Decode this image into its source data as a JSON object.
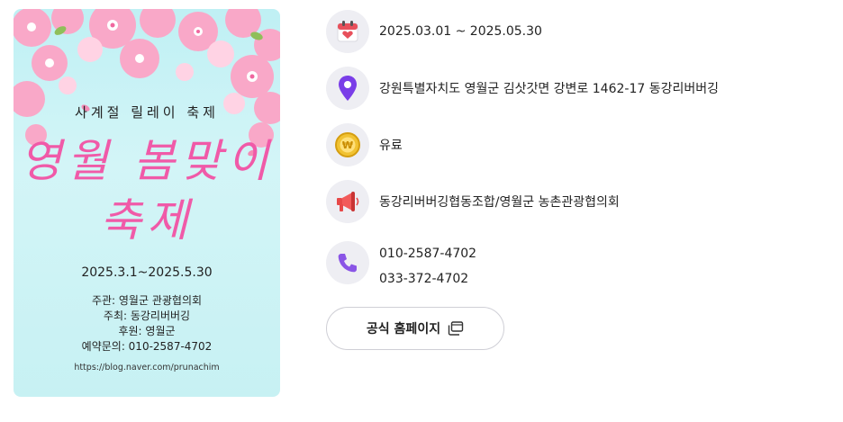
{
  "poster": {
    "subtitle": "사계절 릴레이 축제",
    "title_line1": "영월 봄맞이",
    "title_line2": "축제",
    "dates": "2025.3.1~2025.5.30",
    "organizer": "주관: 영월군 관광협의회",
    "host": "주최: 동강리버버깅",
    "sponsor": "후원: 영월군",
    "reservation": "예약문의: 010-2587-4702",
    "url": "https://blog.naver.com/prunachim"
  },
  "info": {
    "period": "2025.03.01 ~ 2025.05.30",
    "address": "강원특별자치도 영월군 김삿갓면 강변로 1462-17 동강리버버깅",
    "fee": "유료",
    "organizer": "동강리버버깅협동조합/영월군 농촌관광협의회",
    "phone1": "010-2587-4702",
    "phone2": "033-372-4702",
    "homepage_button": "공식 홈페이지"
  },
  "icons": {
    "calendar": "calendar-heart-icon",
    "location": "map-pin-icon",
    "fee": "coin-icon",
    "organizer": "megaphone-icon",
    "phone": "phone-icon",
    "external": "new-window-icon"
  },
  "colors": {
    "poster_title": "#f05aa8",
    "icon_bg": "#eeeef3",
    "pin": "#7a3ee8",
    "phone": "#8a55e6"
  }
}
